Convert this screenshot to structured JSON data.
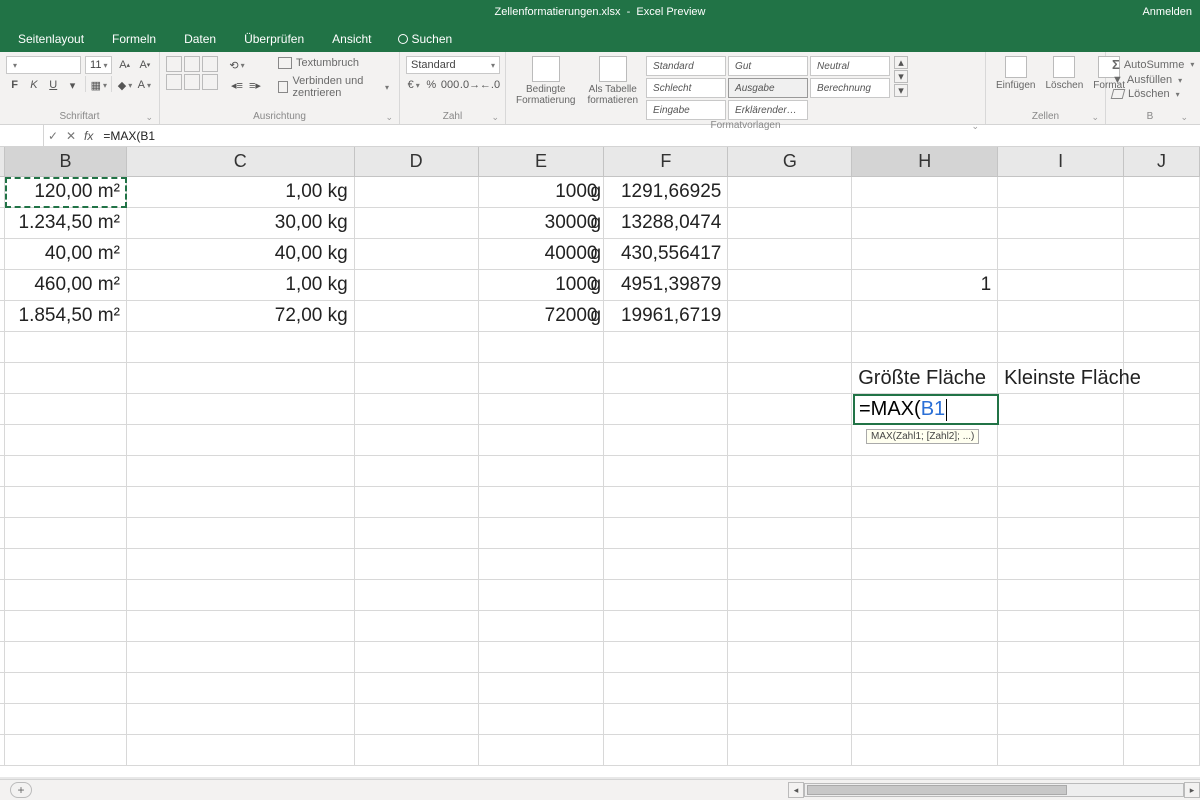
{
  "title": {
    "filename": "Zellenformatierungen.xlsx",
    "app": "Excel Preview",
    "signin": "Anmelden"
  },
  "tabs": {
    "t0": "Seitenlayout",
    "t1": "Formeln",
    "t2": "Daten",
    "t3": "Überprüfen",
    "t4": "Ansicht",
    "search": "Suchen"
  },
  "ribbon": {
    "font": {
      "size": "11",
      "label": "Schriftart",
      "bold": "F",
      "italic": "K",
      "underline": "U"
    },
    "align": {
      "wrap": "Textumbruch",
      "merge": "Verbinden und zentrieren",
      "label": "Ausrichtung"
    },
    "number": {
      "format": "Standard",
      "label": "Zahl"
    },
    "styles": {
      "cond": "Bedingte\nFormatierung",
      "table": "Als Tabelle\nformatieren",
      "s0": "Standard",
      "s1": "Gut",
      "s2": "Neutral",
      "s3": "Schlecht",
      "s4": "Ausgabe",
      "s5": "Berechnung",
      "s6": "Eingabe",
      "s7": "Erklärender…",
      "label": "Formatvorlagen"
    },
    "cells": {
      "insert": "Einfügen",
      "delete": "Löschen",
      "format": "Format",
      "label": "Zellen"
    },
    "edit": {
      "sum": "AutoSumme",
      "fill": "Ausfüllen",
      "clear": "Löschen",
      "label": "B"
    }
  },
  "formula_bar": {
    "namebox": "",
    "formula": "=MAX(B1"
  },
  "columns": {
    "B": "B",
    "C": "C",
    "D": "D",
    "E": "E",
    "F": "F",
    "G": "G",
    "H": "H",
    "I": "I",
    "J": "J"
  },
  "cells": {
    "B1": "120,00 m²",
    "C1": "1,00 kg",
    "E1": "1000",
    "F1l": "g",
    "F1": "1291,66925",
    "B2": "1.234,50 m²",
    "C2": "30,00 kg",
    "E2": "30000",
    "F2l": "g",
    "F2": "13288,0474",
    "B3": "40,00 m²",
    "C3": "40,00 kg",
    "E3": "40000",
    "F3l": "g",
    "F3": "430,556417",
    "B4": "460,00 m²",
    "C4": "1,00 kg",
    "E4": "1000",
    "F4l": "g",
    "F4": "4951,39879",
    "H4": "1",
    "B5": "1.854,50 m²",
    "C5": "72,00 kg",
    "E5": "72000",
    "F5l": "g",
    "F5": "19961,6719",
    "H7": "Größte Fläche",
    "I7": "Kleinste Fläche",
    "H8_formula": "=MAX(",
    "H8_ref": "B1"
  },
  "tooltip": {
    "text": "MAX(Zahl1; [Zahl2]; ...)"
  }
}
